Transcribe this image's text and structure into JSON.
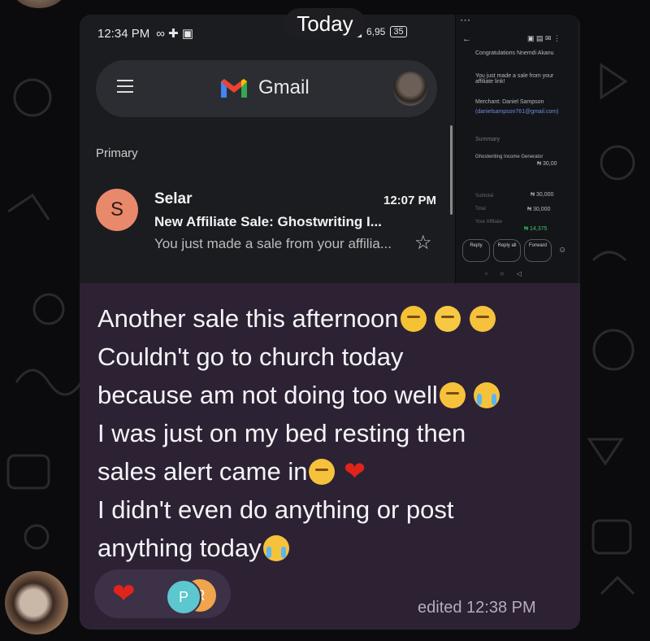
{
  "date_pill": "Today",
  "gmail_screenshot": {
    "status_time": "12:34 PM",
    "status_right": "6,95",
    "battery": "35",
    "app_name": "Gmail",
    "section": "Primary",
    "email": {
      "avatar_letter": "S",
      "sender": "Selar",
      "time": "12:07 PM",
      "subject": "New Affiliate Sale: Ghostwriting I...",
      "snippet": "You just made a sale from your affilia..."
    },
    "mini_detail": {
      "line1": "Congratulations Nnemdi Akanu",
      "line2": "You just made a sale from your affiliate link!",
      "merchant": "Merchant: Daniel Sampson",
      "email": "(danielsampson761@gmail.com)",
      "summary": "Summary",
      "product": "Ghostwriting Income Generator",
      "amount1": "₦ 30,00",
      "subtotal_label": "Subtotal",
      "subtotal_value": "₦ 30,000",
      "total_label": "Total",
      "total_value": "₦ 30,000",
      "affiliate_label": "Your Affiliate",
      "affiliate_value": "₦ 14,375",
      "buttons": [
        "Reply",
        "Reply all",
        "Forward"
      ]
    }
  },
  "message": {
    "lines": [
      "Another sale this afternoon",
      "Couldn't go to church today",
      "because am not doing too well",
      "I was just on my bed resting then",
      "sales alert came in",
      "I didn't even do anything or post",
      "anything today"
    ],
    "reaction_avatar_1": "P",
    "reaction_avatar_2": "R",
    "edited": "edited 12:38 PM"
  }
}
